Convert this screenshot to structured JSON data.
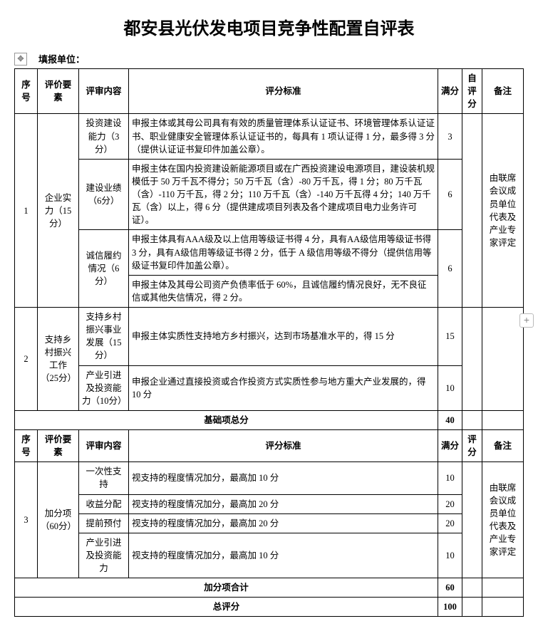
{
  "title": "都安县光伏发电项目竞争性配置自评表",
  "filler_label": "填报单位：",
  "move_icon": "move-arrows-icon",
  "plus_icon": "plus-icon",
  "headers": {
    "seq": "序号",
    "factor": "评价要素",
    "item": "评审内容",
    "criteria": "评分标准",
    "full": "满分",
    "self": "自评分",
    "score": "评分",
    "note": "备注"
  },
  "row1": {
    "seq": "1",
    "factor": "企业实力（15分）",
    "note": "由联席会议成员单位代表及产业专家评定",
    "items": [
      {
        "name": "投资建设能力（3分）",
        "criteria": "申报主体或其母公司具有有效的质量管理体系认证证书、环境管理体系认证证书、职业健康安全管理体系认证证书的，每具有 1 项认证得 1 分，最多得 3 分（提供认证证书复印件加盖公章）。",
        "full": "3"
      },
      {
        "name": "建设业绩（6分）",
        "criteria": "申报主体在国内投资建设新能源项目或在广西投资建设电源项目，建设装机规模低于 50 万千瓦不得分；50 万千瓦（含）-80 万千瓦，得 1 分；80 万千瓦（含）-110 万千瓦，得 2 分；110 万千瓦（含）-140 万千瓦得 4 分；140 万千瓦（含）以上，得 6 分（提供建成项目列表及各个建成项目电力业务许可证）。",
        "full": "6"
      },
      {
        "name": "诚信履约情况（6分）",
        "criteria1": "申报主体具有AAA级及以上信用等级证书得 4 分，具有AA级信用等级证书得 3 分，具有A级信用等级证书得 2 分，低于 A 级信用等级不得分（提供信用等级证书复印件加盖公章）。",
        "criteria2": "申报主体及其母公司资产负债率低于 60%，且诚信履约情况良好，无不良征信或其他失信情况，得 2 分。",
        "full": "6"
      }
    ]
  },
  "row2": {
    "seq": "2",
    "factor": "支持乡村振兴工作（25分）",
    "items": [
      {
        "name": "支持乡村振兴事业发展（15分）",
        "criteria": "申报主体实质性支持地方乡村振兴，达到市场基准水平的，得 15 分",
        "full": "15"
      },
      {
        "name": "产业引进及投资能力（10分）",
        "criteria": "申报企业通过直接投资或合作投资方式实质性参与地方重大产业发展的，得 10 分",
        "full": "10"
      }
    ]
  },
  "subtotal_base": {
    "label": "基础项总分",
    "full": "40"
  },
  "row3": {
    "seq": "3",
    "factor": "加分项（60分）",
    "note": "由联席会议成员单位代表及产业专家评定",
    "items": [
      {
        "name": "一次性支持",
        "criteria": "视支持的程度情况加分，最高加 10 分",
        "full": "10"
      },
      {
        "name": "收益分配",
        "criteria": "视支持的程度情况加分，最高加 20 分",
        "full": "20"
      },
      {
        "name": "提前预付",
        "criteria": "视支持的程度情况加分，最高加 20 分",
        "full": "20"
      },
      {
        "name": "产业引进及投资能力",
        "criteria": "视支持的程度情况加分，最高加 10 分",
        "full": "10"
      }
    ]
  },
  "subtotal_bonus": {
    "label": "加分项合计",
    "full": "60"
  },
  "total": {
    "label": "总评分",
    "full": "100"
  }
}
